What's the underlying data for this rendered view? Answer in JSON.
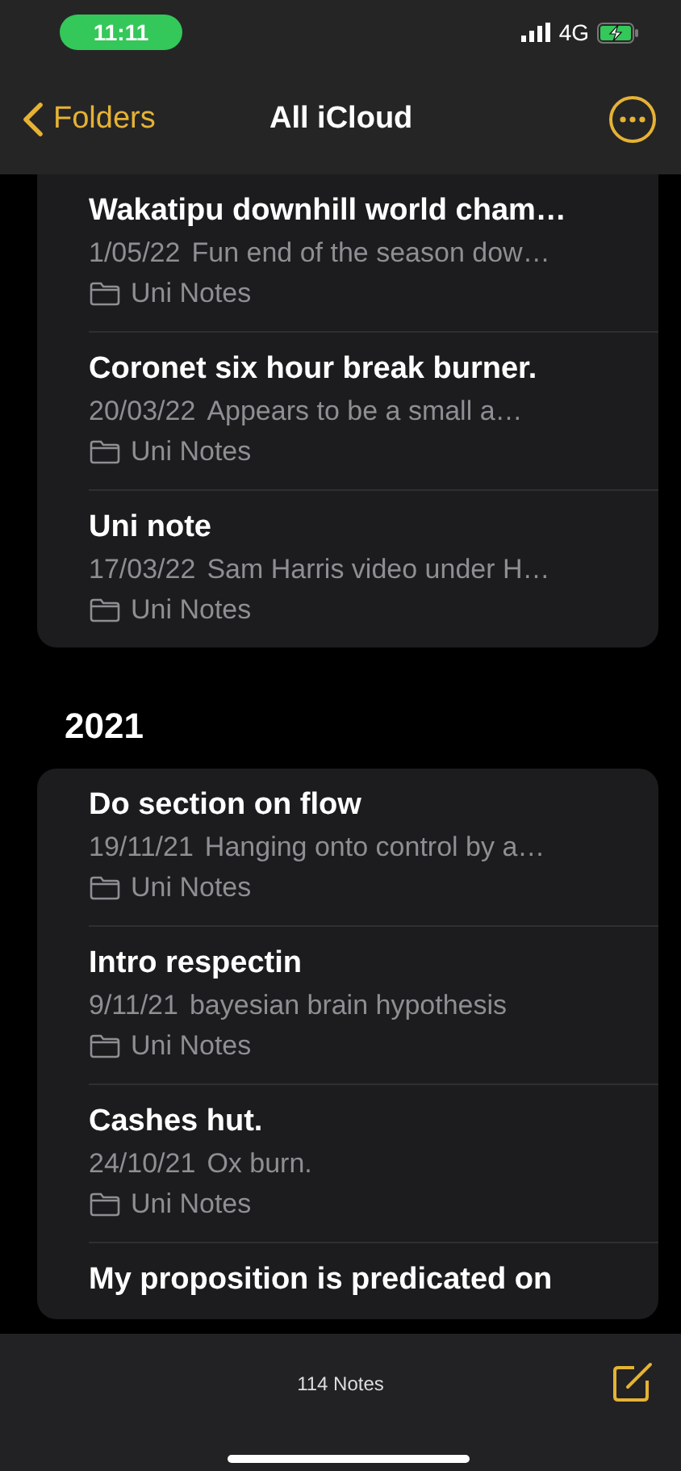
{
  "status_bar": {
    "time": "11:11",
    "network": "4G"
  },
  "nav": {
    "back": "Folders",
    "title": "All iCloud"
  },
  "sections": [
    {
      "notes": [
        {
          "title": "Wakatipu downhill world cham…",
          "date": "1/05/22",
          "snippet": "Fun end of the season dow…",
          "folder": "Uni Notes"
        },
        {
          "title": "Coronet six hour break burner.",
          "date": "20/03/22",
          "snippet": "Appears to be a small a…",
          "folder": "Uni Notes"
        },
        {
          "title": "Uni note",
          "date": "17/03/22",
          "snippet": "Sam Harris video under H…",
          "folder": "Uni Notes"
        }
      ]
    },
    {
      "header": "2021",
      "notes": [
        {
          "title": "Do section on flow",
          "date": "19/11/21",
          "snippet": "Hanging onto control by a…",
          "folder": "Uni Notes"
        },
        {
          "title": "Intro respectin",
          "date": "9/11/21",
          "snippet": "bayesian brain hypothesis",
          "folder": "Uni Notes"
        },
        {
          "title": "Cashes hut.",
          "date": "24/10/21",
          "snippet": "Ox burn.",
          "folder": "Uni Notes"
        },
        {
          "title": "My proposition is predicated on"
        }
      ]
    }
  ],
  "toolbar": {
    "count": "114 Notes"
  }
}
